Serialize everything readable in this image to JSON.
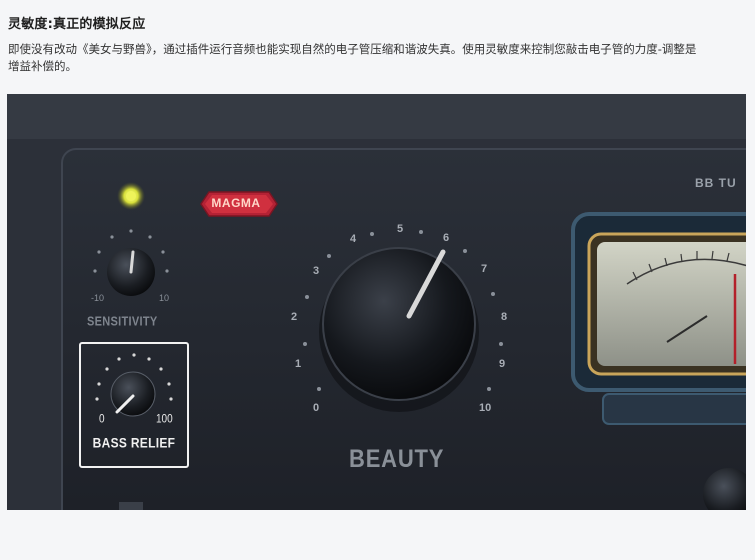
{
  "heading": "灵敏度:真正的模拟反应",
  "description": "即使没有改动《美女与野兽》，通过插件运行音频也能实现自然的电子管压缩和谐波失真。使用灵敏度来控制您敲击电子管的力度-调整是增益补偿的。",
  "plugin": {
    "brand_logo": "MAGMA",
    "product_name_partial": "BB TU",
    "sensitivity": {
      "label": "SENSITIVITY",
      "min_label": "-10",
      "max_label": "10"
    },
    "beauty": {
      "label": "BEAUTY",
      "scale": [
        "0",
        "1",
        "2",
        "3",
        "4",
        "5",
        "6",
        "7",
        "8",
        "9",
        "10"
      ]
    },
    "bass_relief": {
      "label": "BASS RELIEF",
      "min_label": "0",
      "max_label": "100"
    },
    "colors": {
      "panel": "#22262e",
      "logo_red": "#c0283a",
      "led_yellow": "#e6e84a",
      "highlight_box": "#f2f2f2",
      "vu_face": "#b9bcae"
    }
  }
}
